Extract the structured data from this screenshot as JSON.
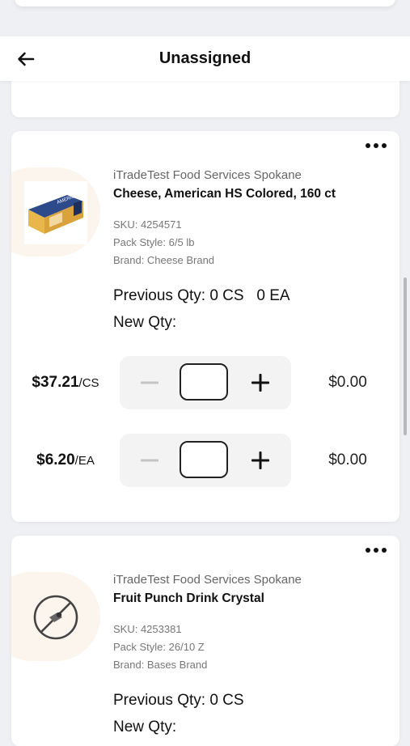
{
  "header": {
    "title": "Unassigned"
  },
  "items": [
    {
      "vendor": "iTradeTest Food Services Spokane",
      "name": "Cheese, American HS Colored, 160 ct",
      "sku": "SKU: 4254571",
      "pack_style": "Pack Style: 6/5 lb",
      "brand": "Brand: Cheese Brand",
      "previous_qty": "Previous Qty: 0 CS   0 EA",
      "new_qty_label": "New Qty:",
      "prices": [
        {
          "price": "$37.21",
          "unit": "/CS",
          "qty": "",
          "total": "$0.00"
        },
        {
          "price": "$6.20",
          "unit": "/EA",
          "qty": "",
          "total": "$0.00"
        }
      ]
    },
    {
      "vendor": "iTradeTest Food Services Spokane",
      "name": "Fruit Punch Drink Crystal",
      "sku": "SKU: 4253381",
      "pack_style": "Pack Style: 26/10 Z",
      "brand": "Brand: Bases Brand",
      "previous_qty": "Previous Qty: 0 CS",
      "new_qty_label": "New Qty:"
    }
  ]
}
